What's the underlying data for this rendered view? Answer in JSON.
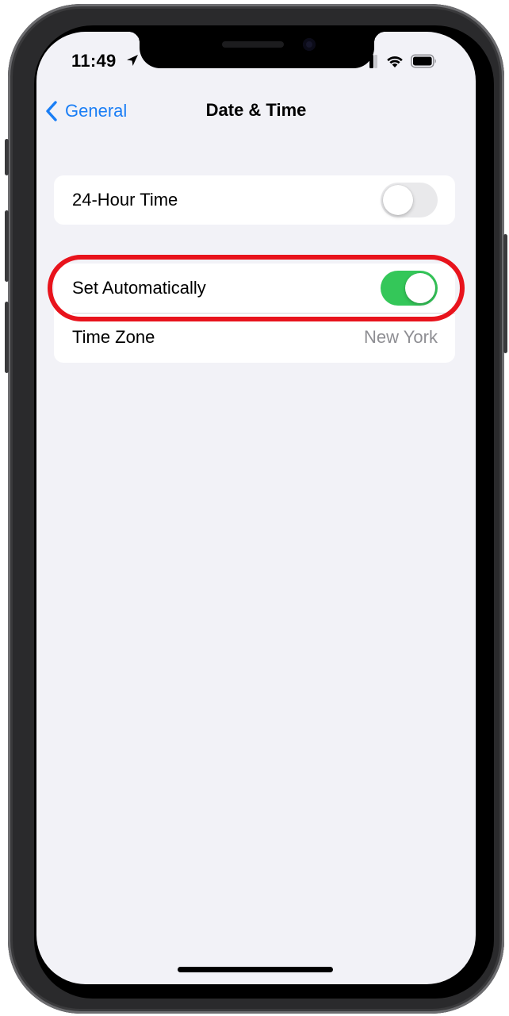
{
  "status_bar": {
    "time": "11:49"
  },
  "nav": {
    "back_label": "General",
    "title": "Date & Time"
  },
  "settings": {
    "hour_24": {
      "label": "24-Hour Time",
      "enabled": false
    },
    "set_automatically": {
      "label": "Set Automatically",
      "enabled": true
    },
    "time_zone": {
      "label": "Time Zone",
      "value": "New York"
    }
  },
  "colors": {
    "accent": "#1a7ef5",
    "toggle_on": "#34c759",
    "highlight": "#e8131c",
    "background": "#f2f2f7"
  }
}
